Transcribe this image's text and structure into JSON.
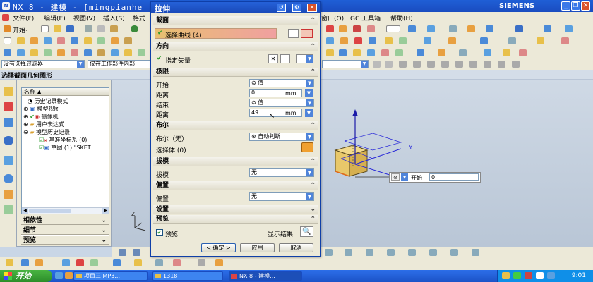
{
  "window": {
    "title": "NX 8 - 建模 - [mingpianhe",
    "brand": "SIEMENS",
    "controls": [
      "minimize-icon",
      "restore-icon",
      "close-icon"
    ]
  },
  "menu": {
    "left": [
      "文件(F)",
      "编辑(E)",
      "视图(V)",
      "插入(S)",
      "格式"
    ],
    "right": [
      "窗口(O)",
      "GC 工具箱",
      "帮助(H)"
    ]
  },
  "toolbar": {
    "start_label": "开始·"
  },
  "filter": {
    "selection_filter": "没有选择过滤器",
    "scope": "仅在工作部件内部"
  },
  "cue": {
    "text": "选择截面几何图形"
  },
  "navigator": {
    "header": "名称",
    "nodes": [
      {
        "label": "历史记录模式"
      },
      {
        "label": "模型视图"
      },
      {
        "label": "摄像机"
      },
      {
        "label": "用户表达式"
      },
      {
        "label": "模型历史记录"
      },
      {
        "label": "基准坐标系 (0)"
      },
      {
        "label": "草图 (1) \"SKET..."
      }
    ],
    "sections": [
      "相依性",
      "细节",
      "预览"
    ]
  },
  "dialog": {
    "title": "拉伸",
    "section": {
      "label": "截面",
      "select_curve": "选择曲线 (4)"
    },
    "direction": {
      "label": "方向",
      "vector": "指定矢量"
    },
    "limits": {
      "label": "极限",
      "start_label": "开始",
      "start_value": "值",
      "distance1_label": "距离",
      "distance1_value": "0",
      "unit1": "mm",
      "end_label": "结束",
      "end_value": "值",
      "distance2_label": "距离",
      "distance2_value": "49",
      "unit2": "mm"
    },
    "boolean": {
      "label": "布尔",
      "boolean_label": "布尔（无）",
      "boolean_value": "自动判断",
      "select_body": "选择体 (0)"
    },
    "draft": {
      "label": "拔模",
      "draft_label": "拔模",
      "draft_value": "无"
    },
    "offset": {
      "label": "偏置",
      "offset_label": "偏置",
      "offset_value": "无"
    },
    "settings": {
      "label": "设置"
    },
    "preview": {
      "label": "预览",
      "preview_check": "预览",
      "show_result": "显示结果"
    },
    "buttons": {
      "ok": "< 确定 >",
      "apply": "应用",
      "cancel": "取消"
    }
  },
  "onscreen_input": {
    "label": "开始",
    "value": "0"
  },
  "axes": {
    "x": "X",
    "y": "Y",
    "z": "Z"
  },
  "taskbar": {
    "start": "开始",
    "items": [
      "项目三 MP3...",
      "1318",
      "NX 8 - 建模..."
    ],
    "clock": "9:01"
  },
  "colors": {
    "accent": "#1f5fd6",
    "selection_highlight": "#f0a0a0",
    "solid_body": "#e8c86a"
  }
}
